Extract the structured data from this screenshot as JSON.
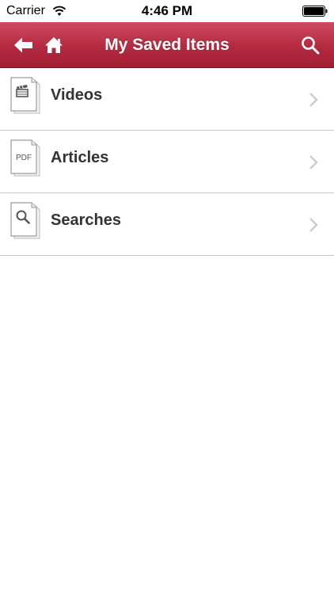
{
  "status_bar": {
    "carrier": "Carrier",
    "time": "4:46 PM"
  },
  "nav_bar": {
    "title": "My Saved Items",
    "color": "#b42a40",
    "icons": [
      "back-arrow-icon",
      "home-icon",
      "search-icon"
    ]
  },
  "list": {
    "items": [
      {
        "label": "Videos",
        "icon": "video-document-icon"
      },
      {
        "label": "Articles",
        "icon": "pdf-document-icon",
        "icon_text": "PDF"
      },
      {
        "label": "Searches",
        "icon": "search-document-icon"
      }
    ]
  }
}
